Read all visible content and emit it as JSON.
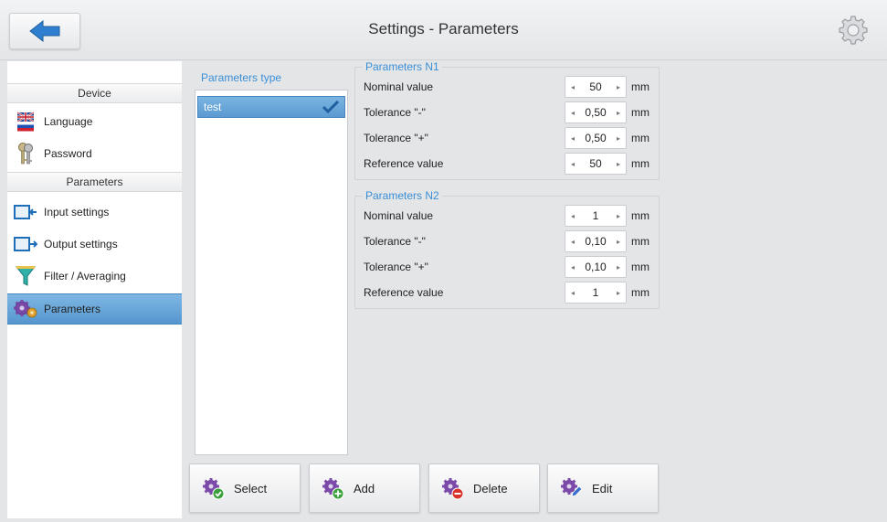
{
  "header": {
    "title": "Settings - Parameters",
    "back_icon": "arrow-left-icon",
    "settings_icon": "gear-icon"
  },
  "sidebar": {
    "sections": [
      {
        "label": "Device"
      },
      {
        "label": "Parameters"
      }
    ],
    "items": [
      {
        "label": "Language",
        "icon": "flag-icon"
      },
      {
        "label": "Password",
        "icon": "keys-icon"
      },
      {
        "label": "Input settings",
        "icon": "input-icon"
      },
      {
        "label": "Output settings",
        "icon": "output-icon"
      },
      {
        "label": "Filter / Averaging",
        "icon": "filter-icon"
      },
      {
        "label": "Parameters",
        "icon": "gears-icon",
        "active": true
      }
    ]
  },
  "params_type": {
    "label": "Parameters type",
    "items": [
      {
        "label": "test",
        "selected": true
      }
    ]
  },
  "groups": [
    {
      "title": "Parameters N1",
      "rows": [
        {
          "label": "Nominal value",
          "value": "50",
          "unit": "mm"
        },
        {
          "label": "Tolerance \"-\"",
          "value": "0,50",
          "unit": "mm"
        },
        {
          "label": "Tolerance \"+\"",
          "value": "0,50",
          "unit": "mm"
        },
        {
          "label": "Reference value",
          "value": "50",
          "unit": "mm"
        }
      ]
    },
    {
      "title": "Parameters N2",
      "rows": [
        {
          "label": "Nominal value",
          "value": "1",
          "unit": "mm"
        },
        {
          "label": "Tolerance \"-\"",
          "value": "0,10",
          "unit": "mm"
        },
        {
          "label": "Tolerance \"+\"",
          "value": "0,10",
          "unit": "mm"
        },
        {
          "label": "Reference value",
          "value": "1",
          "unit": "mm"
        }
      ]
    }
  ],
  "stepper_arrows": {
    "left": "◂",
    "right": "▸"
  },
  "actions": [
    {
      "label": "Select",
      "badge_color": "#3aa13a"
    },
    {
      "label": "Add",
      "badge_color": "#3aa13a"
    },
    {
      "label": "Delete",
      "badge_color": "#d9342b"
    },
    {
      "label": "Edit",
      "badge_color": "#3a6fd0"
    }
  ],
  "colors": {
    "accent": "#3a8ed6",
    "selection": "#5b9ad1",
    "gear": "#7b4aa8"
  }
}
